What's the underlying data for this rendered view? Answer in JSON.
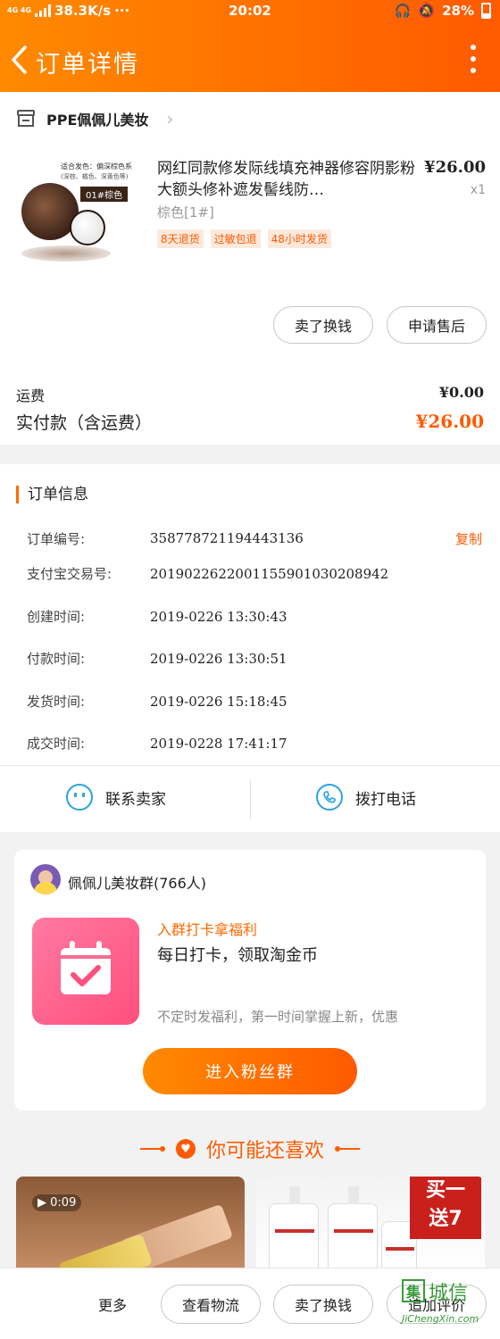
{
  "status_bar": {
    "network": "4G 4G",
    "speed": "38.3K/s",
    "dots": "···",
    "time": "20:02",
    "battery": "28%"
  },
  "header": {
    "title": "订单详情"
  },
  "shop": {
    "name": "PPE佩佩儿美妆",
    "chevron": "›"
  },
  "product": {
    "title": "网红同款修发际线填充神器修容阴影粉大额头修补遮发髻线防…",
    "price": "¥26.00",
    "qty": "x1",
    "spec": "棕色[1#]",
    "tags": [
      "8天退货",
      "过敏包退",
      "48小时发货"
    ],
    "image_caption": "适合发色：偏深棕色系",
    "image_caption2": "(深棕、橘色、深黄色等)",
    "image_label": "01#棕色"
  },
  "product_actions": {
    "sell_label": "卖了换钱",
    "aftersale_label": "申请售后"
  },
  "fees": {
    "shipping_label": "运费",
    "shipping_value": "¥0.00",
    "paid_label": "实付款（含运费）",
    "paid_value": "¥26.00"
  },
  "order_info": {
    "title": "订单信息",
    "copy_label": "复制",
    "rows": [
      {
        "label": "订单编号:",
        "value": "358778721194443136"
      },
      {
        "label": "支付宝交易号:",
        "value": "2019022622001155901030208942"
      },
      {
        "label": "创建时间:",
        "value": "2019-0226 13:30:43"
      },
      {
        "label": "付款时间:",
        "value": "2019-0226 13:30:51"
      },
      {
        "label": "发货时间:",
        "value": "2019-0226 15:18:45"
      },
      {
        "label": "成交时间:",
        "value": "2019-0228 17:41:17"
      }
    ]
  },
  "contact": {
    "seller_label": "联系卖家",
    "call_label": "拨打电话"
  },
  "group": {
    "name": "佩佩儿美妆群(766人)",
    "promo_title": "入群打卡拿福利",
    "promo_sub": "每日打卡，领取淘金币",
    "promo_desc": "不定时发福利，第一时间掌握上新，优惠",
    "join_label": "进入粉丝群"
  },
  "recommend": {
    "title": "你可能还喜欢",
    "video_duration": "0:09",
    "promo_badge_1": "买一",
    "promo_badge_2": "送7"
  },
  "bottom_bar": {
    "more_label": "更多",
    "logistics_label": "查看物流",
    "sell_label": "卖了换钱",
    "review_label": "追加评价"
  },
  "watermark": {
    "logo_char": "集",
    "name": "城信",
    "url": "JiChengXin.com"
  },
  "colors": {
    "brand_orange": "#ff5a00",
    "link_blue": "#2aa3e0"
  }
}
